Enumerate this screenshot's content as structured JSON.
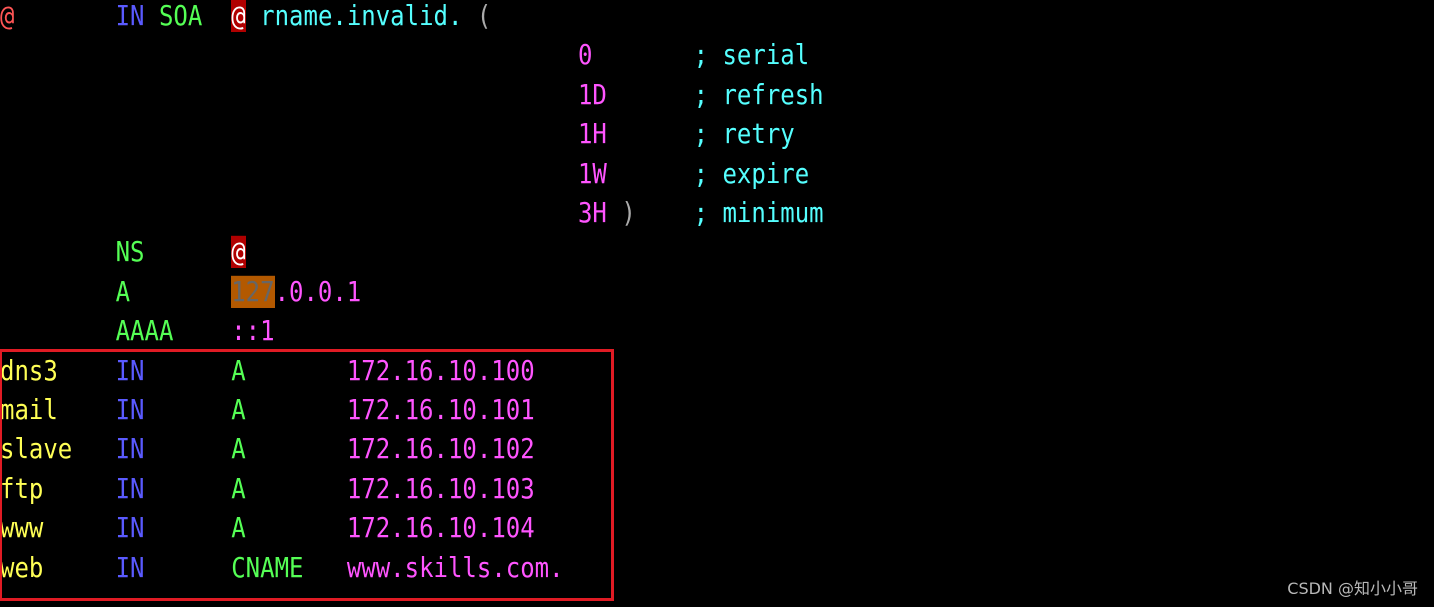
{
  "colors": {
    "red": "#ff5555",
    "blue": "#5a5aff",
    "green": "#55ff55",
    "cyan": "#55ffff",
    "magenta": "#ff55ff",
    "yellow": "#ffff55",
    "grey": "#aaaaaa",
    "highlight_box": "#e01b24"
  },
  "terminal": {
    "lines": [
      [
        {
          "t": "@",
          "c": "red"
        },
        {
          "t": "       "
        },
        {
          "t": "IN",
          "c": "blue"
        },
        {
          "t": " "
        },
        {
          "t": "SOA",
          "c": "green"
        },
        {
          "t": "  "
        },
        {
          "t": "@",
          "c": "hl-red"
        },
        {
          "t": " "
        },
        {
          "t": "rname.invalid.",
          "c": "cyan"
        },
        {
          "t": " "
        },
        {
          "t": "(",
          "c": "grey"
        }
      ],
      [
        {
          "t": "                                        "
        },
        {
          "t": "0",
          "c": "magenta"
        },
        {
          "t": "       "
        },
        {
          "t": "; serial",
          "c": "cyan"
        }
      ],
      [
        {
          "t": "                                        "
        },
        {
          "t": "1D",
          "c": "magenta"
        },
        {
          "t": "      "
        },
        {
          "t": "; refresh",
          "c": "cyan"
        }
      ],
      [
        {
          "t": "                                        "
        },
        {
          "t": "1H",
          "c": "magenta"
        },
        {
          "t": "      "
        },
        {
          "t": "; retry",
          "c": "cyan"
        }
      ],
      [
        {
          "t": "                                        "
        },
        {
          "t": "1W",
          "c": "magenta"
        },
        {
          "t": "      "
        },
        {
          "t": "; expire",
          "c": "cyan"
        }
      ],
      [
        {
          "t": "                                        "
        },
        {
          "t": "3H",
          "c": "magenta"
        },
        {
          "t": " )",
          "c": "grey"
        },
        {
          "t": "    "
        },
        {
          "t": "; minimum",
          "c": "cyan"
        }
      ],
      [
        {
          "t": "        "
        },
        {
          "t": "NS",
          "c": "green"
        },
        {
          "t": "      "
        },
        {
          "t": "@",
          "c": "hl-red"
        }
      ],
      [
        {
          "t": "        "
        },
        {
          "t": "A",
          "c": "green"
        },
        {
          "t": "       "
        },
        {
          "t": "127",
          "c": "hl-orange"
        },
        {
          "t": ".0.0.1",
          "c": "magenta"
        }
      ],
      [
        {
          "t": "        "
        },
        {
          "t": "AAAA",
          "c": "green"
        },
        {
          "t": "    "
        },
        {
          "t": "::1",
          "c": "magenta"
        }
      ],
      [
        {
          "t": "dns3",
          "c": "yellow"
        },
        {
          "t": "    "
        },
        {
          "t": "IN",
          "c": "blue"
        },
        {
          "t": "      "
        },
        {
          "t": "A",
          "c": "green"
        },
        {
          "t": "       "
        },
        {
          "t": "172.16.10.100",
          "c": "magenta"
        }
      ],
      [
        {
          "t": "mail",
          "c": "yellow"
        },
        {
          "t": "    "
        },
        {
          "t": "IN",
          "c": "blue"
        },
        {
          "t": "      "
        },
        {
          "t": "A",
          "c": "green"
        },
        {
          "t": "       "
        },
        {
          "t": "172.16.10.101",
          "c": "magenta"
        }
      ],
      [
        {
          "t": "slave",
          "c": "yellow"
        },
        {
          "t": "   "
        },
        {
          "t": "IN",
          "c": "blue"
        },
        {
          "t": "      "
        },
        {
          "t": "A",
          "c": "green"
        },
        {
          "t": "       "
        },
        {
          "t": "172.16.10.102",
          "c": "magenta"
        }
      ],
      [
        {
          "t": "ftp",
          "c": "yellow"
        },
        {
          "t": "     "
        },
        {
          "t": "IN",
          "c": "blue"
        },
        {
          "t": "      "
        },
        {
          "t": "A",
          "c": "green"
        },
        {
          "t": "       "
        },
        {
          "t": "172.16.10.103",
          "c": "magenta"
        }
      ],
      [
        {
          "t": "www",
          "c": "yellow"
        },
        {
          "t": "     "
        },
        {
          "t": "IN",
          "c": "blue"
        },
        {
          "t": "      "
        },
        {
          "t": "A",
          "c": "green"
        },
        {
          "t": "       "
        },
        {
          "t": "172.16.10.104",
          "c": "magenta"
        }
      ],
      [
        {
          "t": "web",
          "c": "yellow"
        },
        {
          "t": "     "
        },
        {
          "t": "IN",
          "c": "blue"
        },
        {
          "t": "      "
        },
        {
          "t": "CNAME",
          "c": "green"
        },
        {
          "t": "   "
        },
        {
          "t": "www.skills.com.",
          "c": "magenta"
        }
      ]
    ]
  },
  "watermark": "CSDN @知小小哥"
}
